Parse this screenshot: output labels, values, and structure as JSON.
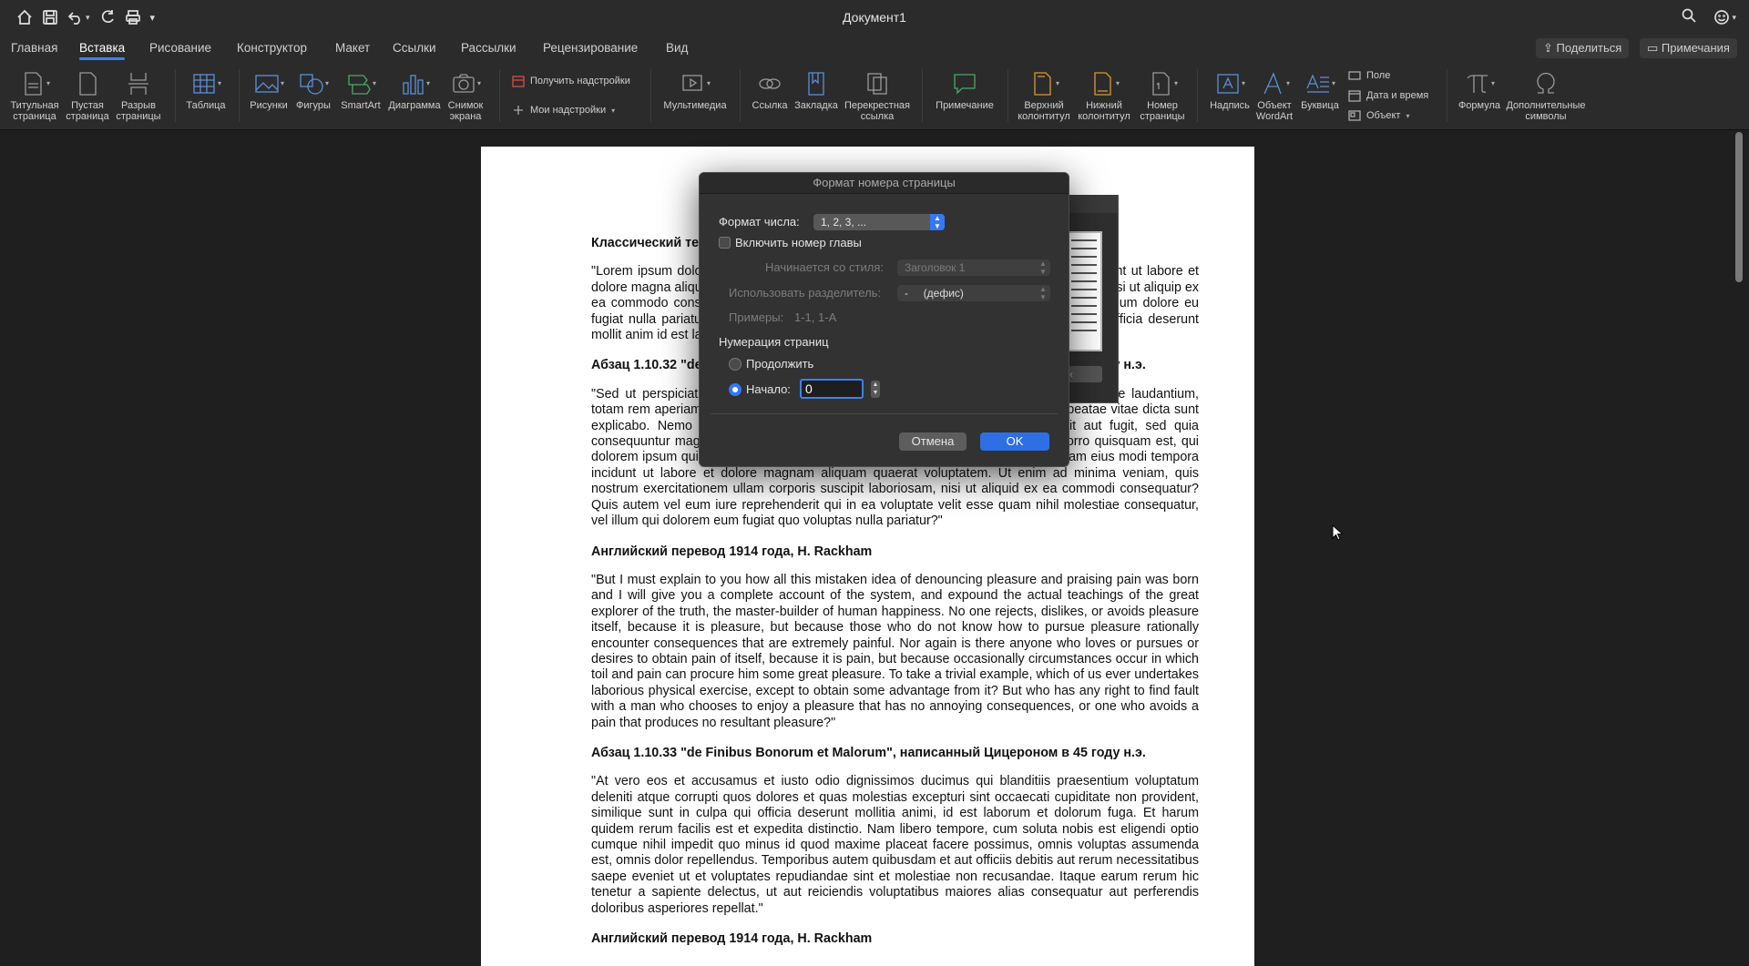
{
  "app": {
    "doc_title": "Документ1"
  },
  "quick_access": {
    "home_icon": "home-icon",
    "save_icon": "save-icon",
    "undo_icon": "undo-icon",
    "redo_icon": "redo-icon",
    "print_icon": "print-icon",
    "customize_glyph": "▾"
  },
  "tabs": [
    {
      "label": "Главная"
    },
    {
      "label": "Вставка"
    },
    {
      "label": "Рисование"
    },
    {
      "label": "Конструктор"
    },
    {
      "label": "Макет"
    },
    {
      "label": "Ссылки"
    },
    {
      "label": "Рассылки"
    },
    {
      "label": "Рецензирование"
    },
    {
      "label": "Вид"
    }
  ],
  "header_buttons": {
    "share": "Поделиться",
    "comments": "Примечания"
  },
  "ribbon": {
    "cover_page": [
      "Титульная",
      "страница"
    ],
    "blank_page": [
      "Пустая",
      "страница"
    ],
    "page_break": [
      "Разрыв",
      "страницы"
    ],
    "table": "Таблица",
    "pictures": "Рисунки",
    "shapes": "Фигуры",
    "smartart": "SmartArt",
    "chart": "Диаграмма",
    "screenshot": [
      "Снимок",
      "экрана"
    ],
    "get_addins": "Получить надстройки",
    "my_addins": "Мои надстройки",
    "media": "Мультимедиа",
    "link": "Ссылка",
    "bookmark": "Закладка",
    "cross_ref": [
      "Перекрестная",
      "ссылка"
    ],
    "comment": "Примечание",
    "header": [
      "Верхний",
      "колонтитул"
    ],
    "footer": [
      "Нижний",
      "колонтитул"
    ],
    "page_number": [
      "Номер",
      "страницы"
    ],
    "textbox": "Надпись",
    "wordart": [
      "Объект",
      "WordArt"
    ],
    "dropcap": "Буквица",
    "field": "Поле",
    "date_time": "Дата и время",
    "object": "Объект",
    "equation": "Формула",
    "symbols": [
      "Дополнительные",
      "символы"
    ]
  },
  "document": {
    "h1": "Классический текст Lorem Ipsum, используемый с XVI века",
    "p1": "\"Lorem ipsum dolor sit amet, consectetur adipiscing elit, sed do eiusmod tempor incididunt ut labore et dolore magna aliqua. Ut enim ad minim veniam, quis nostrud exercitation ullamco laboris nisi ut aliquip ex ea commodo consequat. Duis aute irure dolor in reprehenderit in voluptate velit esse cillum dolore eu fugiat nulla pariatur. Excepteur sint occaecat cupidatat non proident, sunt in culpa qui officia deserunt mollit anim id est laborum.\"",
    "h2": "Абзац 1.10.32 \"de Finibus Bonorum et Malorum\", написанный Цицероном в 45 году н.э.",
    "p2": "\"Sed ut perspiciatis unde omnis iste natus error sit voluptatem accusantium doloremque laudantium, totam rem aperiam, eaque ipsa quae ab illo inventore veritatis et quasi architecto beatae vitae dicta sunt explicabo. Nemo enim ipsam voluptatem quia voluptas sit aspernatur aut odit aut fugit, sed quia consequuntur magni dolores eos qui ratione voluptatem sequi nesciunt. Neque porro quisquam est, qui dolorem ipsum quia dolor sit amet, consectetur, adipisci velit, sed quia non numquam eius modi tempora incidunt ut labore et dolore magnam aliquam quaerat voluptatem. Ut enim ad minima veniam, quis nostrum exercitationem ullam corporis suscipit laboriosam, nisi ut aliquid ex ea commodi consequatur? Quis autem vel eum iure reprehenderit qui in ea voluptate velit esse quam nihil molestiae consequatur, vel illum qui dolorem eum fugiat quo voluptas nulla pariatur?\"",
    "h3": "Английский перевод 1914 года, H. Rackham",
    "p3": "\"But I must explain to you how all this mistaken idea of denouncing pleasure and praising pain was born and I will give you a complete account of the system, and expound the actual teachings of the great explorer of the truth, the master-builder of human happiness. No one rejects, dislikes, or avoids pleasure itself, because it is pleasure, but because those who do not know how to pursue pleasure rationally encounter consequences that are extremely painful. Nor again is there anyone who loves or pursues or desires to obtain pain of itself, because it is pain, but because occasionally circumstances occur in which toil and pain can procure him some great pleasure. To take a trivial example, which of us ever undertakes laborious physical exercise, except to obtain some advantage from it? But who has any right to find fault with a man who chooses to enjoy a pleasure that has no annoying consequences, or one who avoids a pain that produces no resultant pleasure?\"",
    "h4": "Абзац 1.10.33 \"de Finibus Bonorum et Malorum\", написанный Цицероном в 45 году н.э.",
    "p4": "\"At vero eos et accusamus et iusto odio dignissimos ducimus qui blanditiis praesentium voluptatum deleniti atque corrupti quos dolores et quas molestias excepturi sint occaecati cupiditate non provident, similique sunt in culpa qui officia deserunt mollitia animi, id est laborum et dolorum fuga. Et harum quidem rerum facilis est et expedita distinctio. Nam libero tempore, cum soluta nobis est eligendi optio cumque nihil impedit quo minus id quod maxime placeat facere possimus, omnis voluptas assumenda est, omnis dolor repellendus. Temporibus autem quibusdam et aut officiis debitis aut rerum necessitatibus saepe eveniet ut et voluptates repudiandae sint et molestiae non recusandae. Itaque earum rerum hic tenetur a sapiente delectus, ut aut reiciendis voluptatibus maiores alias consequatur aut perferendis doloribus asperiores repellat.\"",
    "h5": "Английский перевод 1914 года, H. Rackham"
  },
  "dialog": {
    "title": "Формат номера страницы",
    "number_format_label": "Формат числа:",
    "number_format_value": "1, 2, 3, ...",
    "include_chapter_label": "Включить номер главы",
    "starts_with_style_label": "Начинается со стиля:",
    "starts_with_style_value": "Заголовок 1",
    "use_separator_label": "Использовать разделитель:",
    "use_separator_value": "-     (дефис)",
    "examples_label": "Примеры:",
    "examples_value": "1-1, 1-A",
    "page_numbering_label": "Нумерация страниц",
    "continue_label": "Продолжить",
    "start_at_label": "Начало:",
    "start_at_value": "0",
    "cancel": "Отмена",
    "ok": "OK"
  },
  "colors": {
    "accent": "#3478f6",
    "ok_button": "#2f6fe4",
    "background": "#1f1f1f",
    "ribbon": "#2b2b2b"
  }
}
